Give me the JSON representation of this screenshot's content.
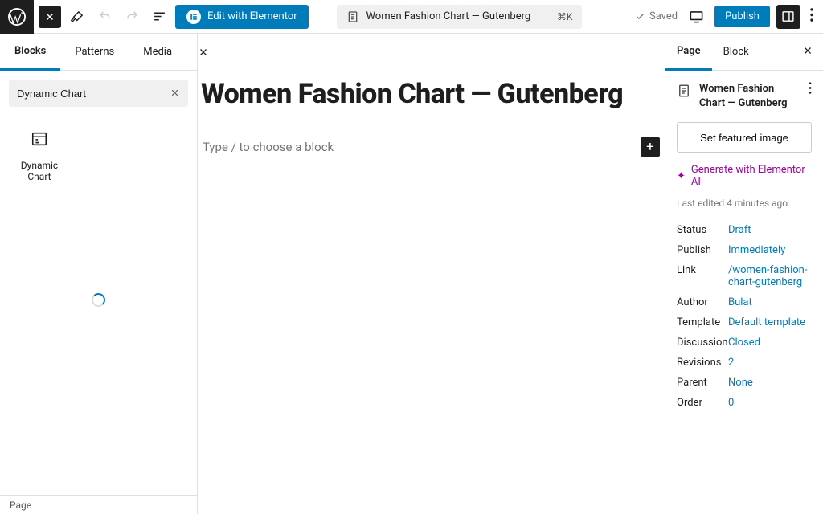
{
  "topbar": {
    "elementor_label": "Edit with Elementor",
    "title": "Women Fashion Chart — Gutenberg",
    "cmd": "⌘K",
    "saved": "Saved",
    "publish": "Publish"
  },
  "inserter": {
    "tabs": [
      "Blocks",
      "Patterns",
      "Media"
    ],
    "active_tab": "Blocks",
    "search_value": "Dynamic Chart",
    "block_result": {
      "icon": "chart-icon",
      "label": "Dynamic Chart"
    },
    "footer": "Page"
  },
  "canvas": {
    "title": "Women Fashion Chart — Gutenberg",
    "placeholder": "Type / to choose a block"
  },
  "settings": {
    "tabs": [
      "Page",
      "Block"
    ],
    "active_tab": "Page",
    "page_title": "Women Fashion Chart — Gutenberg",
    "featured_btn": "Set featured image",
    "ai_label": "Generate with Elementor AI",
    "last_edited": "Last edited 4 minutes ago.",
    "rows": [
      {
        "k": "Status",
        "v": "Draft"
      },
      {
        "k": "Publish",
        "v": "Immediately"
      },
      {
        "k": "Link",
        "v": "/women-fashion-chart-gutenberg"
      },
      {
        "k": "Author",
        "v": "Bulat"
      },
      {
        "k": "Template",
        "v": "Default template"
      },
      {
        "k": "Discussion",
        "v": "Closed"
      },
      {
        "k": "Revisions",
        "v": "2"
      },
      {
        "k": "Parent",
        "v": "None"
      },
      {
        "k": "Order",
        "v": "0"
      }
    ]
  }
}
